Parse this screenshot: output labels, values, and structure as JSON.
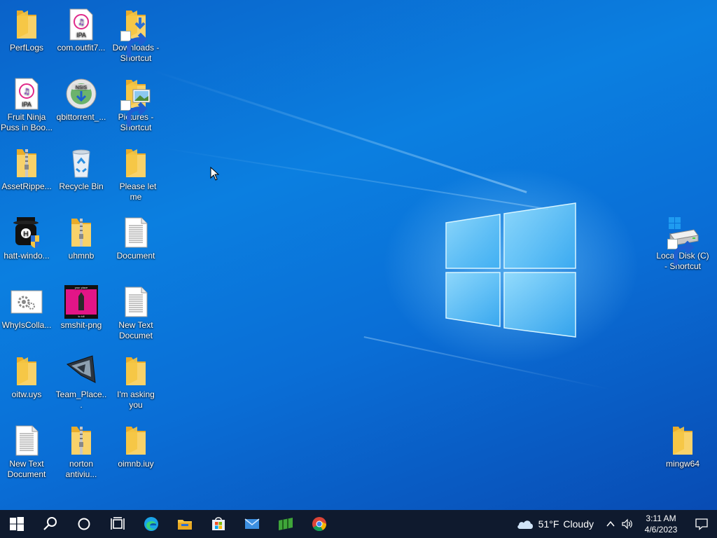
{
  "desktop": {
    "icons": [
      {
        "label": "PerfLogs",
        "kind": "folder"
      },
      {
        "label": "com.outfit7...",
        "kind": "ipa"
      },
      {
        "label": "Downloads - Shortcut",
        "kind": "folder-downloads"
      },
      {
        "label": "Fruit Ninja Puss in Boo...",
        "kind": "ipa"
      },
      {
        "label": "qbittorrent_...",
        "kind": "nsis"
      },
      {
        "label": "Pictures - Shortcut",
        "kind": "folder-pictures"
      },
      {
        "label": "AssetRippe...",
        "kind": "zip-folder"
      },
      {
        "label": "Recycle Bin",
        "kind": "recycle-bin"
      },
      {
        "label": " Please let me",
        "kind": "folder"
      },
      {
        "label": "hatt-windo...",
        "kind": "app-installer"
      },
      {
        "label": "uhmnb",
        "kind": "zip-folder"
      },
      {
        "label": "Document",
        "kind": "text-file"
      },
      {
        "label": "WhyIsColla...",
        "kind": "settings-file"
      },
      {
        "label": "smshit-png",
        "kind": "image-thumb"
      },
      {
        "label": "New Text Documet",
        "kind": "text-file"
      },
      {
        "label": "oitw.uys",
        "kind": "folder"
      },
      {
        "label": "Team_Place...",
        "kind": "app"
      },
      {
        "label": "I'm  asking you",
        "kind": "folder"
      },
      {
        "label": "New Text Document",
        "kind": "text-file"
      },
      {
        "label": "norton antiviu...",
        "kind": "zip-folder"
      },
      {
        "label": "oimnb.iuy",
        "kind": "folder"
      },
      {
        "label": "Local Disk (C) - Shortcut",
        "kind": "drive"
      },
      {
        "label": "mingw64",
        "kind": "folder"
      }
    ],
    "ipa_text": "IPA",
    "nsis_text": "NSIS",
    "thumb_text_top": "your place",
    "thumb_text_bottom": "to kill"
  },
  "taskbar": {
    "items": [
      "start-icon",
      "search-icon",
      "cortana-icon",
      "task-view-icon",
      "edge-icon",
      "file-explorer-icon",
      "store-icon",
      "mail-icon",
      "minecraft-icon",
      "chrome-icon"
    ],
    "weather_temp": "51°F",
    "weather_desc": "Cloudy",
    "time": "3:11 AM",
    "date": "4/6/2023"
  },
  "colors": {
    "taskbar_bg": "#0f1a2e",
    "folder": "#f5c542",
    "accent": "#0a6ed6"
  }
}
